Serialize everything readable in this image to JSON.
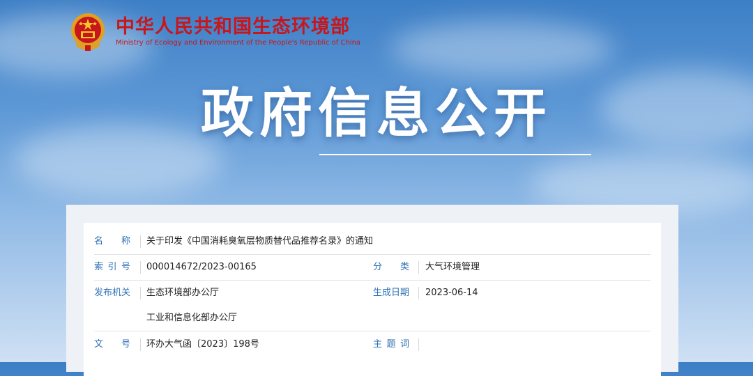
{
  "header": {
    "org_name_cn": "中华人民共和国生态环境部",
    "org_name_en": "Ministry of Ecology and Environment of the People's Republic of China"
  },
  "hero": {
    "title": "政府信息公开"
  },
  "info_table": {
    "name_label": "名称",
    "name_value": "关于印发《中国消耗臭氧层物质替代品推荐名录》的通知",
    "index_label": "索引号",
    "index_value": "000014672/2023-00165",
    "category_label": "分类",
    "category_value": "大气环境管理",
    "publisher_label": "发布机关",
    "publisher_value_1": "生态环境部办公厅",
    "publisher_value_2": "工业和信息化部办公厅",
    "date_label": "生成日期",
    "date_value": "2023-06-14",
    "doc_no_label": "文号",
    "doc_no_value": "环办大气函〔2023〕198号",
    "keywords_label": "主题词",
    "keywords_value": ""
  },
  "colors": {
    "brand_red": "#c8161d",
    "label_blue": "#2c6fb5"
  }
}
